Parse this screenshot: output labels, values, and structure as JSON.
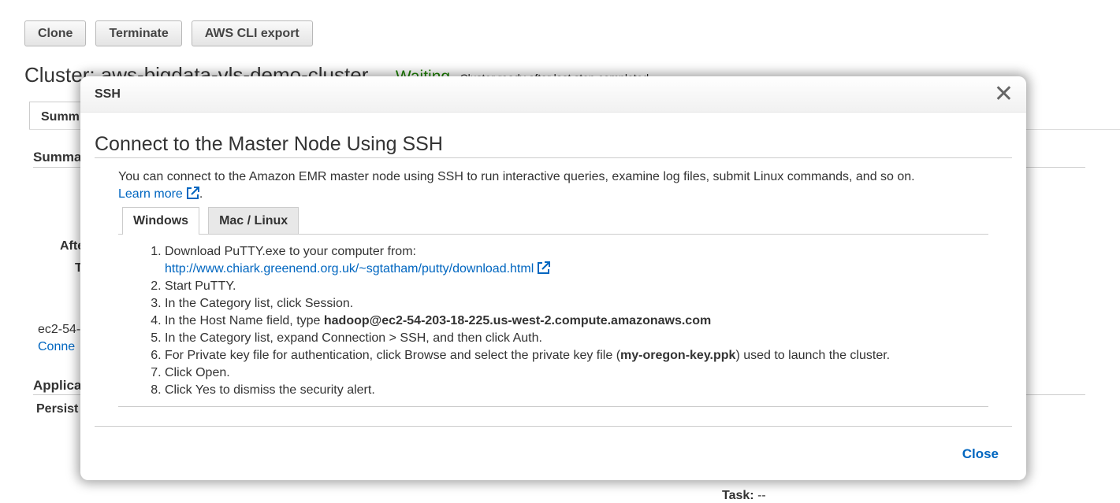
{
  "toolbar": {
    "clone": "Clone",
    "terminate": "Terminate",
    "cli_export": "AWS CLI export"
  },
  "cluster": {
    "title": "Cluster: aws-bigdata-vls-demo-cluster",
    "status": "Waiting",
    "status_msg": "Cluster ready after last step completed.",
    "status_color": "#1d8102"
  },
  "background": {
    "tab_summary": "Summ",
    "section_summary": "Summa",
    "label_after": "Afte",
    "label_t": "T",
    "host_partial": "ec2-54-",
    "connect_partial": "Conne",
    "section_applications": "Applica",
    "label_persistent": "Persist",
    "task_label": "Task:",
    "task_value": "--"
  },
  "modal": {
    "title": "SSH",
    "close_icon": "close-icon",
    "heading": "Connect to the Master Node Using SSH",
    "intro": "You can connect to the Amazon EMR master node using SSH to run interactive queries, examine log files, submit Linux commands, and so on.",
    "learn_more": "Learn more",
    "learn_more_after": ".",
    "tabs": [
      {
        "label": "Windows",
        "active": true
      },
      {
        "label": "Mac / Linux",
        "active": false
      }
    ],
    "steps": {
      "s1": "Download PuTTY.exe to your computer from:",
      "s1_link": "http://www.chiark.greenend.org.uk/~sgtatham/putty/download.html",
      "s2": "Start PuTTY.",
      "s3": "In the Category list, click Session.",
      "s4_prefix": "In the Host Name field, type ",
      "s4_host": "hadoop@ec2-54-203-18-225.us-west-2.compute.amazonaws.com",
      "s5": "In the Category list, expand Connection > SSH, and then click Auth.",
      "s6_prefix": "For Private key file for authentication, click Browse and select the private key file (",
      "s6_key": "my-oregon-key.ppk",
      "s6_suffix": ") used to launch the cluster.",
      "s7": "Click Open.",
      "s8": "Click Yes to dismiss the security alert."
    },
    "close_button": "Close",
    "link_color": "#0066c0"
  }
}
